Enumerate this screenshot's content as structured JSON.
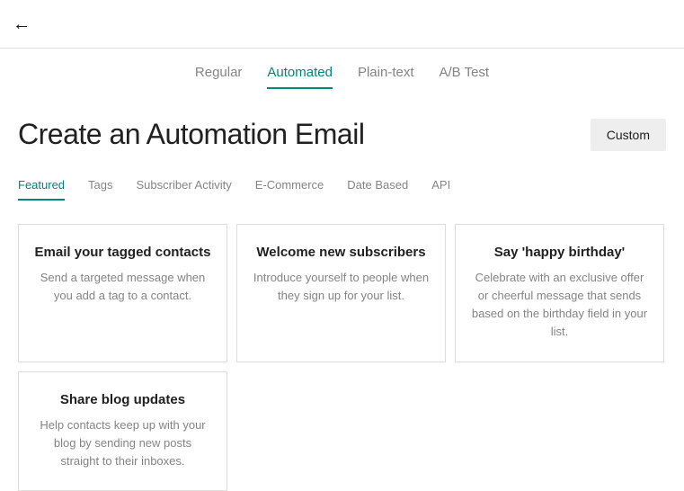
{
  "topbar": {
    "back_glyph": "←"
  },
  "campaign_tabs": [
    {
      "label": "Regular",
      "active": false
    },
    {
      "label": "Automated",
      "active": true
    },
    {
      "label": "Plain-text",
      "active": false
    },
    {
      "label": "A/B Test",
      "active": false
    }
  ],
  "page": {
    "title": "Create an Automation Email",
    "custom_button": "Custom"
  },
  "sub_tabs": [
    {
      "label": "Featured",
      "active": true
    },
    {
      "label": "Tags",
      "active": false
    },
    {
      "label": "Subscriber Activity",
      "active": false
    },
    {
      "label": "E-Commerce",
      "active": false
    },
    {
      "label": "Date Based",
      "active": false
    },
    {
      "label": "API",
      "active": false
    }
  ],
  "cards": [
    {
      "title": "Email your tagged contacts",
      "desc": "Send a targeted message when you add a tag to a contact."
    },
    {
      "title": "Welcome new subscribers",
      "desc": "Introduce yourself to people when they sign up for your list."
    },
    {
      "title": "Say 'happy birthday'",
      "desc": "Celebrate with an exclusive offer or cheerful message that sends based on the birthday field in your list."
    },
    {
      "title": "Share blog updates",
      "desc": "Help contacts keep up with your blog by sending new posts straight to their inboxes."
    }
  ]
}
